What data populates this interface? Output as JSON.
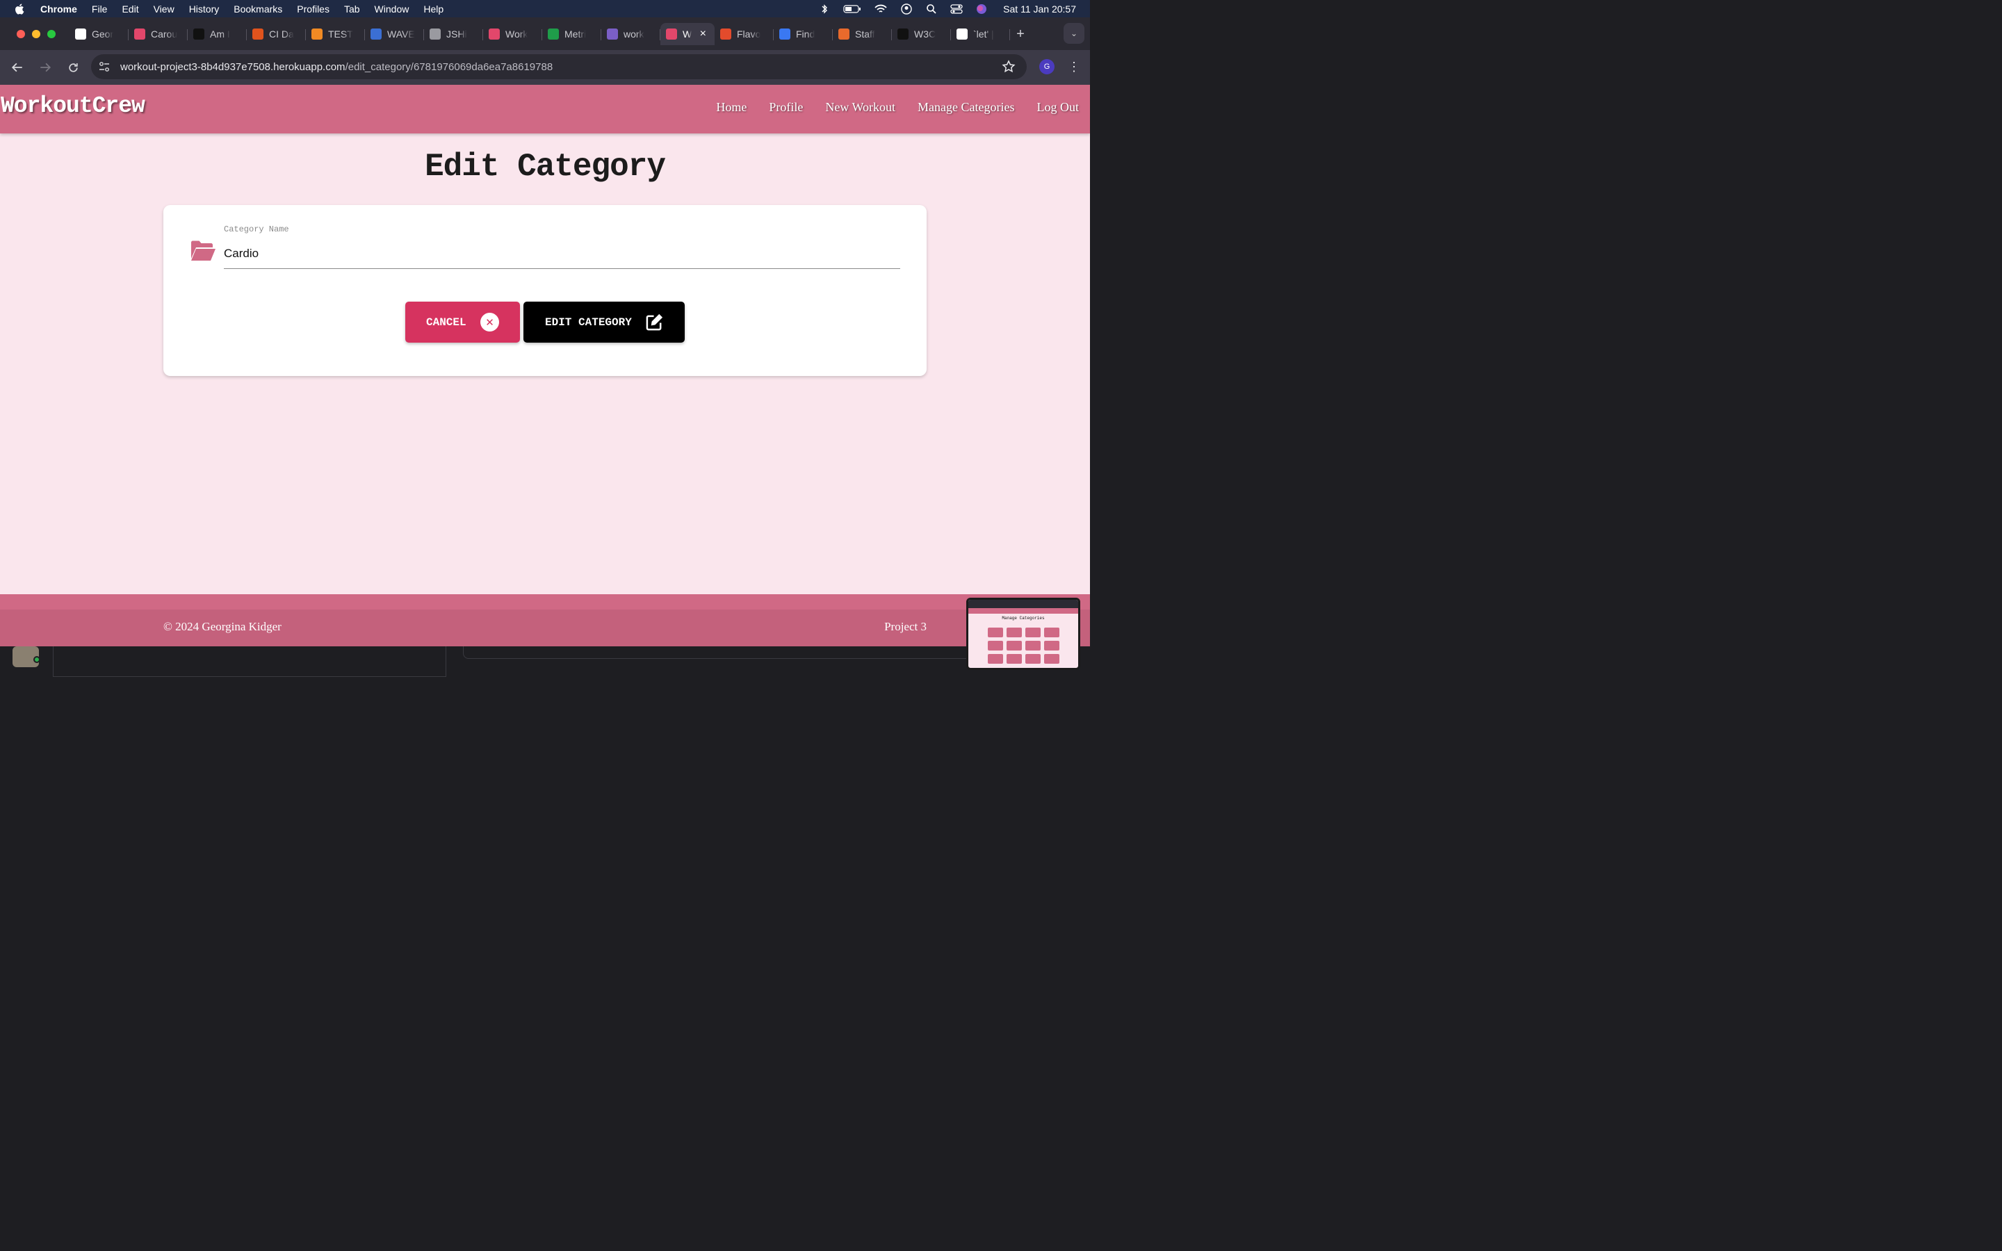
{
  "menubar": {
    "items": [
      "Chrome",
      "File",
      "Edit",
      "View",
      "History",
      "Bookmarks",
      "Profiles",
      "Tab",
      "Window",
      "Help"
    ],
    "clock": "Sat 11 Jan  20:57"
  },
  "browser": {
    "tabs": [
      {
        "title": "Geor",
        "icon": "github-icon",
        "color": "#ffffff"
      },
      {
        "title": "Carou",
        "icon": "dumbbell-icon",
        "color": "#e2476b"
      },
      {
        "title": "Am I",
        "icon": "u-icon",
        "color": "#111111"
      },
      {
        "title": "CI Da",
        "icon": "ring-icon",
        "color": "#e0531d"
      },
      {
        "title": "TEST",
        "icon": "g-icon",
        "color": "#f08a24"
      },
      {
        "title": "WAVE",
        "icon": "wave-icon",
        "color": "#3b6fd4"
      },
      {
        "title": "JSHi",
        "icon": "globe-icon",
        "color": "#9a9aa0"
      },
      {
        "title": "Work",
        "icon": "dumbbell-icon",
        "color": "#e2476b"
      },
      {
        "title": "Metri",
        "icon": "leaf-icon",
        "color": "#1f9d4a"
      },
      {
        "title": "work",
        "icon": "heroku-icon",
        "color": "#7b5fc7"
      },
      {
        "title": "W",
        "icon": "dumbbell-icon",
        "color": "#e2476b",
        "active": true
      },
      {
        "title": "Flavo",
        "icon": "fries-icon",
        "color": "#e34b2c"
      },
      {
        "title": "Find",
        "icon": "flag-icon",
        "color": "#3a78f2"
      },
      {
        "title": "Staff",
        "icon": "ar-icon",
        "color": "#e96a2c"
      },
      {
        "title": "W3C",
        "icon": "w3c-icon",
        "color": "#111111"
      },
      {
        "title": "`let' |",
        "icon": "github-icon",
        "color": "#ffffff"
      }
    ],
    "url_host": "workout-project3-8b4d937e7508.herokuapp.com",
    "url_path": "/edit_category/6781976069da6ea7a8619788",
    "profile_initial": "G"
  },
  "site": {
    "brand": "WorkoutCrew",
    "nav": [
      "Home",
      "Profile",
      "New Workout",
      "Manage Categories",
      "Log Out"
    ],
    "page_title": "Edit Category",
    "form": {
      "label": "Category Name",
      "value": "Cardio"
    },
    "cancel_label": "CANCEL",
    "submit_label": "EDIT CATEGORY",
    "footer_copy": "© 2024 Georgina Kidger",
    "footer_project": "Project 3",
    "accent": "#d06985",
    "cancel_color": "#d6335f"
  },
  "preview": {
    "title": "Manage Categories"
  }
}
